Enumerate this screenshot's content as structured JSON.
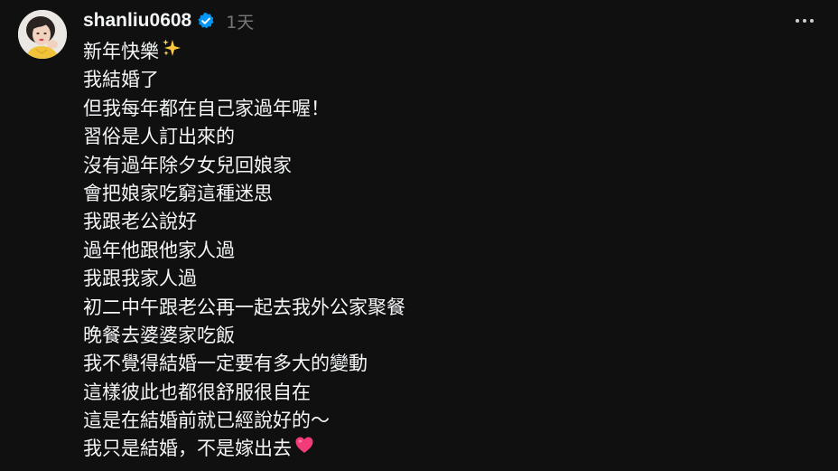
{
  "post": {
    "username": "shanliu0608",
    "timestamp": "1天",
    "verified": true,
    "lines": [
      {
        "text": "新年快樂",
        "emoji": "sparkles-emoji"
      },
      {
        "text": "我結婚了"
      },
      {
        "text": "但我每年都在自己家過年喔！"
      },
      {
        "text": "習俗是人訂出來的"
      },
      {
        "text": "沒有過年除夕女兒回娘家"
      },
      {
        "text": "會把娘家吃窮這種迷思"
      },
      {
        "text": "我跟老公說好"
      },
      {
        "text": "過年他跟他家人過"
      },
      {
        "text": "我跟我家人過"
      },
      {
        "text": "初二中午跟老公再一起去我外公家聚餐"
      },
      {
        "text": "晚餐去婆婆家吃飯"
      },
      {
        "text": "我不覺得結婚一定要有多大的變動"
      },
      {
        "text": "這樣彼此也都很舒服很自在"
      },
      {
        "text": "這是在結婚前就已經說好的～"
      },
      {
        "text": "我只是結婚，不是嫁出去",
        "emoji": "heart-emoji"
      }
    ]
  },
  "icons": {
    "verified": "verified-badge-icon",
    "more": "more-options-icon"
  },
  "colors": {
    "background": "#101010",
    "text": "#f3f5f7",
    "muted": "#777777",
    "verified_blue": "#0095f6",
    "sparkle_gold": "#ffc83d",
    "heart_pink": "#f23c7a"
  }
}
